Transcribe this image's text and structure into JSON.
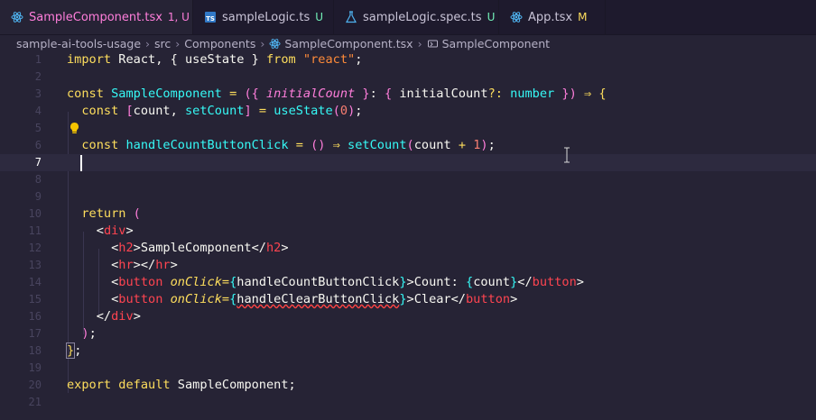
{
  "tabs": [
    {
      "label": "SampleComponent.tsx",
      "status": "1, U",
      "dirty": true,
      "icon": "react-icon"
    },
    {
      "label": "sampleLogic.ts",
      "status": "U",
      "icon": "typescript-icon"
    },
    {
      "label": "sampleLogic.spec.ts",
      "status": "U",
      "icon": "flask-icon"
    },
    {
      "label": "App.tsx",
      "status": "M",
      "icon": "react-icon"
    }
  ],
  "breadcrumb": [
    "sample-ai-tools-usage",
    "src",
    "Components",
    "SampleComponent.tsx",
    "SampleComponent"
  ],
  "colors": {
    "background": "#262335",
    "accent": "#ff7edb",
    "keyword": "#fede5d",
    "function": "#36f9f6",
    "string": "#ff8b39",
    "tag": "#72f1b8"
  },
  "editor": {
    "current_line": 7,
    "lines": [
      {
        "n": "1",
        "t": "import React, { useState } from \"react\";"
      },
      {
        "n": "2",
        "t": ""
      },
      {
        "n": "3",
        "t": "const SampleComponent = ({ initialCount }: { initialCount?: number }) ⇒ {"
      },
      {
        "n": "4",
        "t": "  const [count, setCount] = useState(0);"
      },
      {
        "n": "5",
        "t": ""
      },
      {
        "n": "6",
        "t": "  const handleCountButtonClick = () ⇒ setCount(count + 1);"
      },
      {
        "n": "7",
        "t": ""
      },
      {
        "n": "8",
        "t": ""
      },
      {
        "n": "9",
        "t": ""
      },
      {
        "n": "10",
        "t": "  return ("
      },
      {
        "n": "11",
        "t": "    <div>"
      },
      {
        "n": "12",
        "t": "      <h2>SampleComponent</h2>"
      },
      {
        "n": "13",
        "t": "      <hr></hr>"
      },
      {
        "n": "14",
        "t": "      <button onClick={handleCountButtonClick}>Count: {count}</button>"
      },
      {
        "n": "15",
        "t": "      <button onClick={handleClearButtonClick}>Clear</button>"
      },
      {
        "n": "16",
        "t": "    </div>"
      },
      {
        "n": "17",
        "t": "  );"
      },
      {
        "n": "18",
        "t": "};"
      },
      {
        "n": "19",
        "t": ""
      },
      {
        "n": "20",
        "t": "export default SampleComponent;"
      },
      {
        "n": "21",
        "t": ""
      }
    ]
  }
}
